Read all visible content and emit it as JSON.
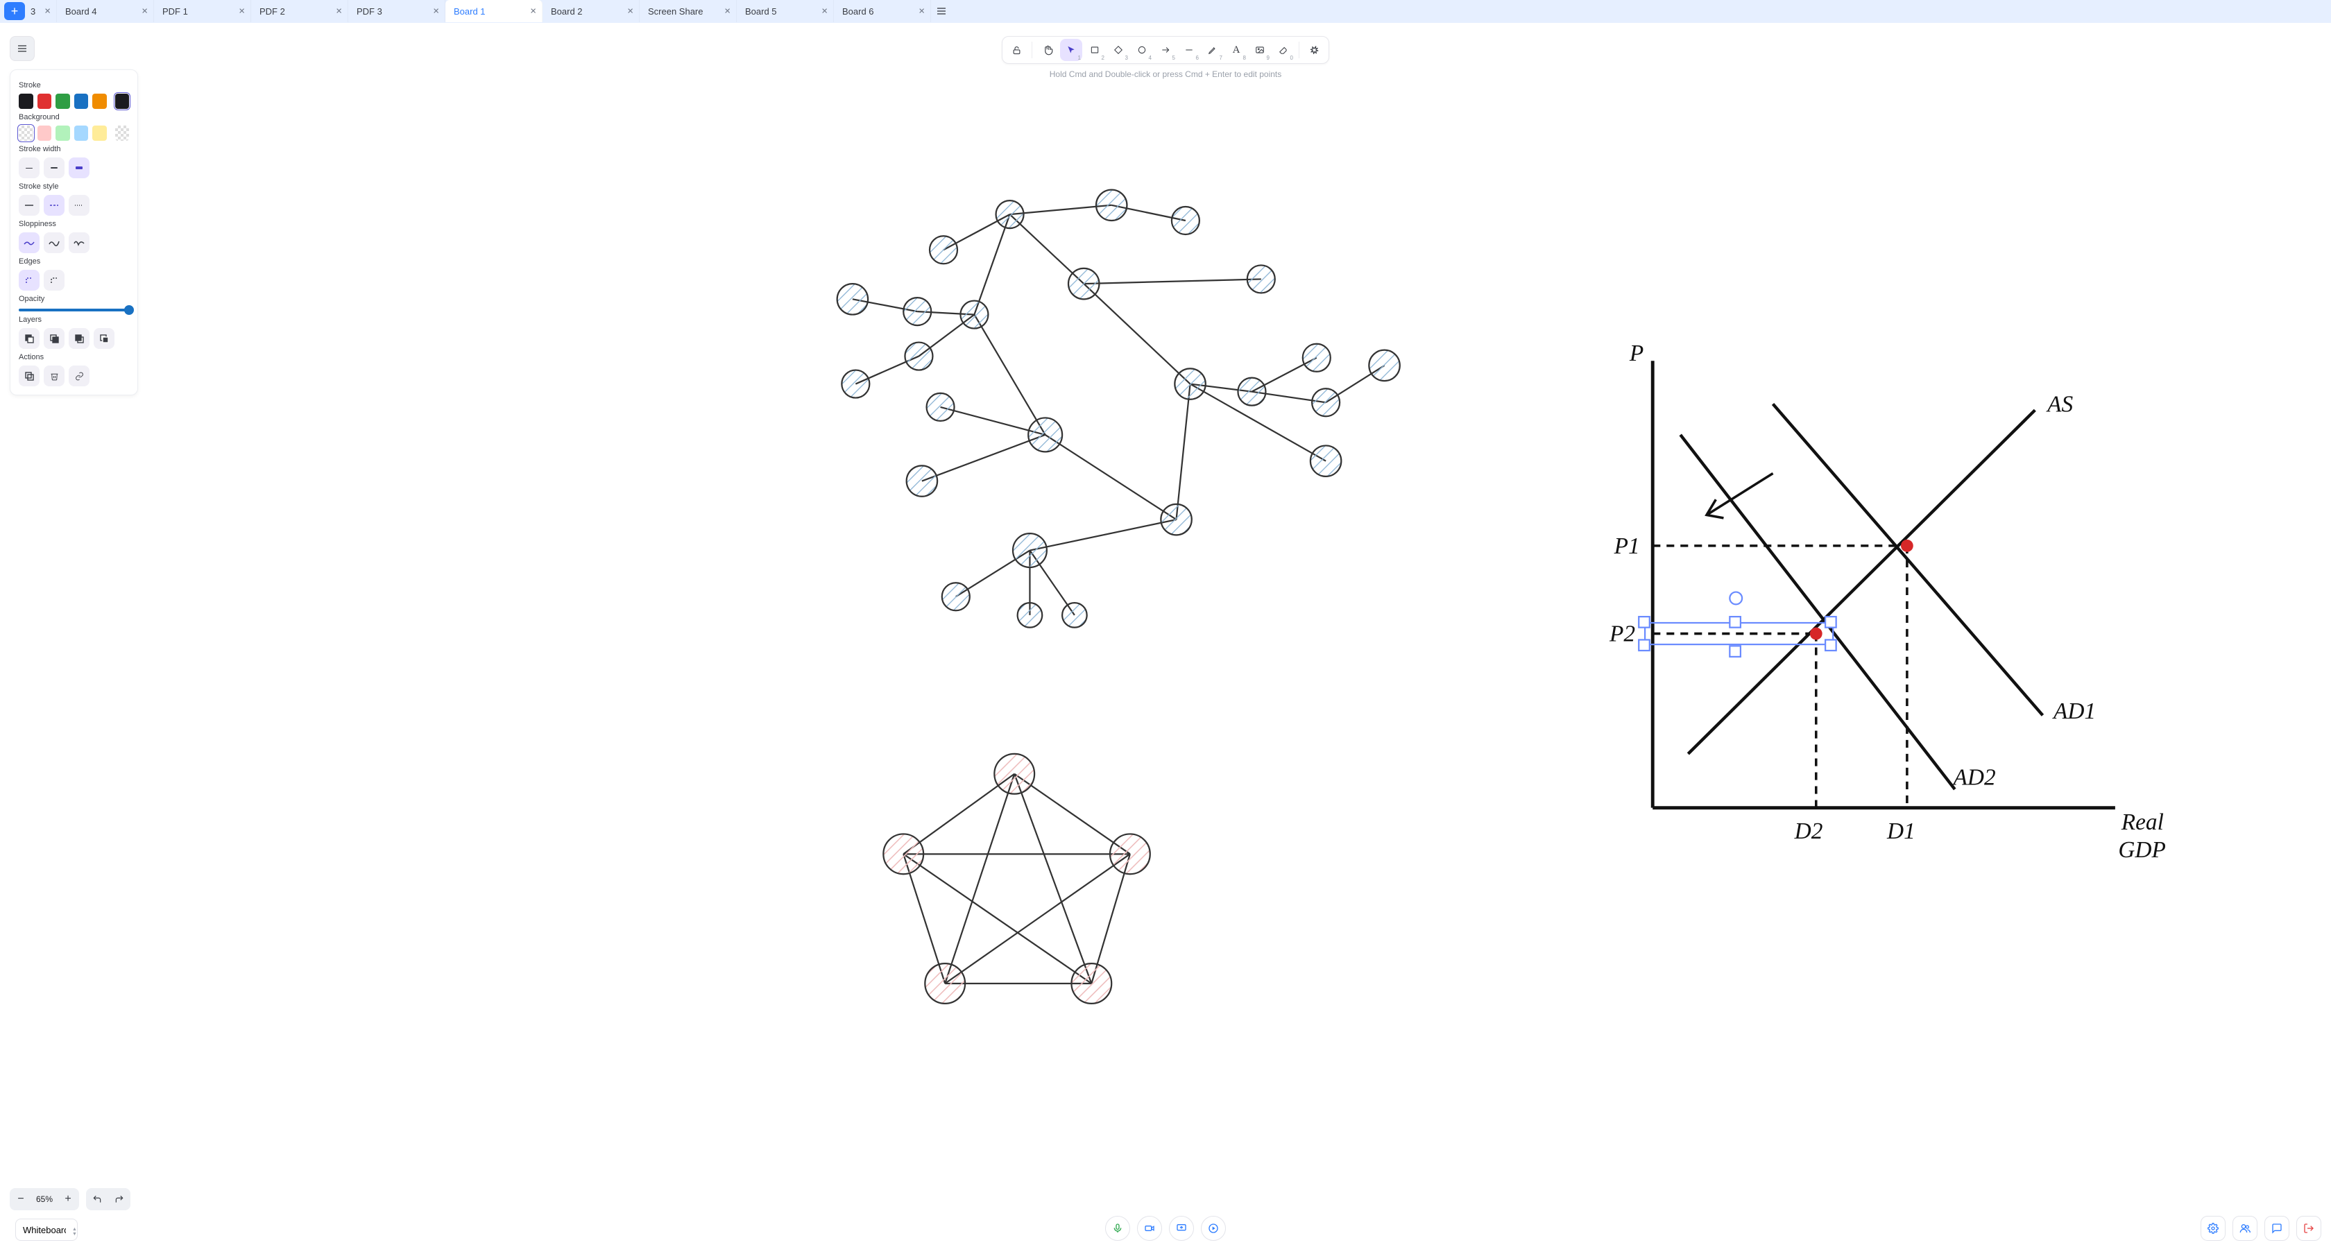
{
  "tabs": {
    "truncated_left_label": "3",
    "items": [
      {
        "label": "Board 4"
      },
      {
        "label": "PDF 1"
      },
      {
        "label": "PDF 2"
      },
      {
        "label": "PDF 3"
      },
      {
        "label": "Board 1",
        "active": true
      },
      {
        "label": "Board 2"
      },
      {
        "label": "Screen Share"
      },
      {
        "label": "Board 5"
      },
      {
        "label": "Board 6"
      }
    ]
  },
  "toolbar": {
    "lock": {
      "hotkey": ""
    },
    "hand": {
      "hotkey": ""
    },
    "select": {
      "hotkey": "1"
    },
    "rectangle": {
      "hotkey": "2"
    },
    "diamond": {
      "hotkey": "3"
    },
    "ellipse": {
      "hotkey": "4"
    },
    "arrow": {
      "hotkey": "5"
    },
    "line": {
      "hotkey": "6"
    },
    "draw": {
      "hotkey": "7"
    },
    "text": {
      "hotkey": "8"
    },
    "image": {
      "hotkey": "9"
    },
    "eraser": {
      "hotkey": "0"
    },
    "laser": {
      "hotkey": ""
    }
  },
  "hint_text": "Hold Cmd and Double-click or press Cmd + Enter to edit points",
  "panel": {
    "stroke_label": "Stroke",
    "background_label": "Background",
    "stroke_width_label": "Stroke width",
    "stroke_style_label": "Stroke style",
    "sloppiness_label": "Sloppiness",
    "edges_label": "Edges",
    "opacity_label": "Opacity",
    "opacity_value": 100,
    "layers_label": "Layers",
    "actions_label": "Actions"
  },
  "zoom": {
    "level": "65%"
  },
  "title_input": "Whiteboard L",
  "econ_graph": {
    "y_axis": "P",
    "x_axis_1": "Real",
    "x_axis_2": "GDP",
    "p1": "P1",
    "p2": "P2",
    "d1": "D1",
    "d2": "D2",
    "as": "AS",
    "ad1": "AD1",
    "ad2": "AD2"
  }
}
